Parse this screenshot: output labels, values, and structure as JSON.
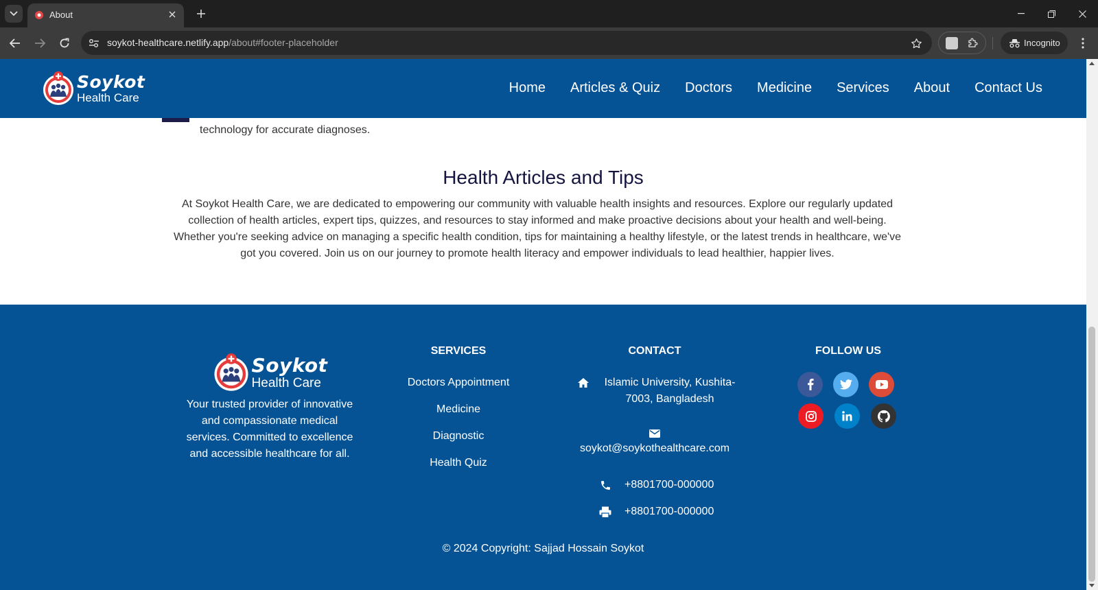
{
  "browser": {
    "tab_title": "About",
    "url_host": "soykot-healthcare.netlify.app",
    "url_path": "/about#footer-placeholder",
    "incognito_label": "Incognito"
  },
  "site": {
    "logo_name": "Soykot",
    "logo_sub": "Health Care",
    "nav": [
      "Home",
      "Articles & Quiz",
      "Doctors",
      "Medicine",
      "Services",
      "About",
      "Contact Us"
    ]
  },
  "feature_cut_text": "technology for accurate diagnoses.",
  "articles": {
    "heading": "Health Articles and Tips",
    "body": "At Soykot Health Care, we are dedicated to empowering our community with valuable health insights and resources. Explore our regularly updated collection of health articles, expert tips, quizzes, and resources to stay informed and make proactive decisions about your health and well-being. Whether you're seeking advice on managing a specific health condition, tips for maintaining a healthy lifestyle, or the latest trends in healthcare, we've got you covered. Join us on our journey to promote health literacy and empower individuals to lead healthier, happier lives."
  },
  "footer": {
    "tagline": "Your trusted provider of innovative and compassionate medical services. Committed to excellence and accessible healthcare for all.",
    "services_title": "SERVICES",
    "services": [
      "Doctors Appointment",
      "Medicine",
      "Diagnostic",
      "Health Quiz"
    ],
    "contact_title": "CONTACT",
    "address": "Islamic University, Kushita-7003, Bangladesh",
    "email": "soykot@soykothealthcare.com",
    "phone": "+8801700-000000",
    "fax": "+8801700-000000",
    "follow_title": "FOLLOW US",
    "social": [
      {
        "name": "facebook",
        "color": "#3b5998"
      },
      {
        "name": "twitter",
        "color": "#55acee"
      },
      {
        "name": "youtube",
        "color": "#dd4b39"
      },
      {
        "name": "instagram",
        "color": "#ed1c24"
      },
      {
        "name": "linkedin",
        "color": "#0082ca"
      },
      {
        "name": "github",
        "color": "#333333"
      }
    ],
    "copyright": "© 2024 Copyright: Sajjad Hossain Soykot"
  },
  "colors": {
    "brand_blue": "#055395",
    "heading_navy": "#14143f"
  }
}
